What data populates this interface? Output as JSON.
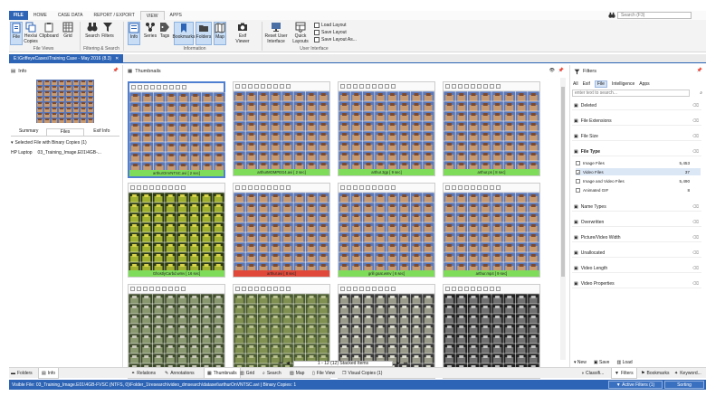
{
  "menu": {
    "file_label": "FILE",
    "tabs": [
      "HOME",
      "CASE DATA",
      "REPORT / EXPORT",
      "VIEW",
      "APPS"
    ],
    "search_placeholder": "Search (F3)"
  },
  "ribbon": {
    "buttons": {
      "file": "File",
      "hexview": "Hex/ai Copies",
      "clipboard": "Clipboard",
      "grid": "Grid",
      "search": "Search",
      "filters": "Filters",
      "info": "Info",
      "series": "Series",
      "tags": "Tags",
      "bookmarks": "Bookmarks",
      "folders": "Folders",
      "map": "Map",
      "exif_viewer": "Exif Viewer",
      "reset_layout": "Reset User Interface",
      "quick_layouts": "Quick Layouts",
      "load_layout": "Load Layout",
      "save_layout": "Save Layout",
      "save_layout_as": "Save Layout As..."
    },
    "groups": {
      "file_views": "File Views",
      "filtering": "Filtering & Search",
      "information": "Information",
      "user_interface": "User Interface"
    }
  },
  "path_tab": "E:\\GriffeyeCases\\Training Case - May 2016 (8.3)",
  "info_panel": {
    "title": "Info",
    "tabs": [
      "Summary",
      "Files",
      "Exif Info"
    ],
    "group_header": "Selected File with Binary Copies (1)",
    "row_source": "HP Laptop",
    "row_path": "03_Training_Image.E01\\4GB-..."
  },
  "thumbnails": {
    "title": "Thumbnails",
    "cards": [
      {
        "caption": "arthurOnVNTSC.avi [ 2 sec]",
        "color": "#7fdc5a"
      },
      {
        "caption": "arthurMOMPEG4.avi [ 2 sec]",
        "color": "#7fdc5a"
      },
      {
        "caption": "arthur.3gp [ 9 sec]",
        "color": "#7fdc5a"
      },
      {
        "caption": "arthur.ps [ 8 sec]",
        "color": "#7fdc5a"
      },
      {
        "caption": "GhostlyCarbd.wmv [ 16 sec]",
        "color": "#7fdc5a"
      },
      {
        "caption": "arthur.avi [ 8 sec]",
        "color": "#e0493a"
      },
      {
        "caption": "grill goat.wmv [ 6 sec]",
        "color": "#7fdc5a"
      },
      {
        "caption": "arthur.mp4 [ 9 sec]",
        "color": "#7fdc5a"
      },
      {
        "caption": "",
        "color": ""
      },
      {
        "caption": "",
        "color": ""
      },
      {
        "caption": "",
        "color": ""
      },
      {
        "caption": "",
        "color": ""
      }
    ],
    "toolbar_icons_row1": "TXA ROW TXX",
    "toolbar_icons_row2": "2 3 ###",
    "footer_count": "1 - 12 (12) Stacked Items"
  },
  "filters_panel": {
    "title": "Filters",
    "tabs": [
      "All",
      "Exif",
      "File",
      "Intelligence",
      "Apps"
    ],
    "search_placeholder": "enter text to search...",
    "sections": [
      "Deleted",
      "File Extensions",
      "File Size",
      "File Type",
      "Name Types",
      "Overwritten",
      "Picture/Video Width",
      "Unallocated",
      "Video Length",
      "Video Properties"
    ],
    "file_type_items": [
      {
        "label": "Image Files",
        "count": "5,453"
      },
      {
        "label": "Video Files",
        "count": "37"
      },
      {
        "label": "Image and Video Files",
        "count": "5,490"
      },
      {
        "label": "Animated GIF",
        "count": "8"
      }
    ],
    "actions": {
      "new": "New",
      "save": "Save",
      "load": "Load"
    }
  },
  "bottom_left_tabs": [
    "Folders",
    "Info"
  ],
  "bottom_center_tabs": [
    "Relations",
    "Annotations",
    "Thumbnails",
    "Grid",
    "Search",
    "Map",
    "File View",
    "Visual Copies (1)"
  ],
  "bottom_right_tabs": [
    "Classifi...",
    "Filters",
    "Bookmarks",
    "Keyword..."
  ],
  "status": {
    "text": "Visible File: 03_Training_Image.E01\\4GB-FVSC (NTFS, 0)\\Folder_1\\research\\video_dmsearch\\dataset\\arthurOnVNTSC.avi  |  Binary Copies: 1",
    "active_filters": "Active Filters (1)",
    "sorting": "Sorting"
  },
  "colors": {
    "accent": "#2d64b5",
    "green_label": "#7fdc5a",
    "red_label": "#e0493a"
  }
}
